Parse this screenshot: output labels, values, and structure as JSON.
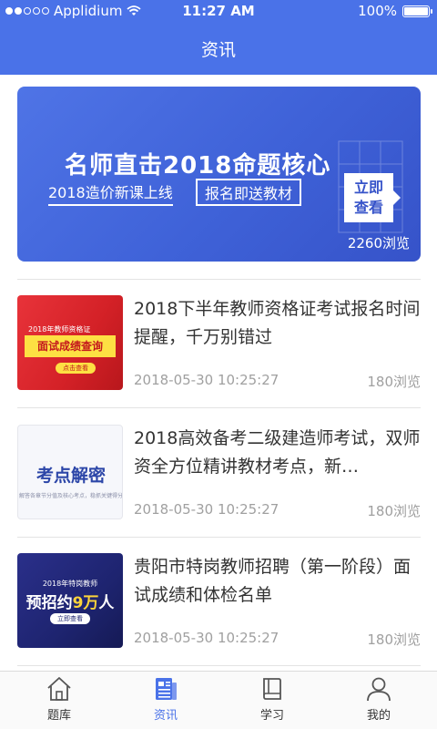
{
  "status_bar": {
    "carrier": "Applidium",
    "time": "11:27 AM",
    "battery": "100%",
    "battery_level": 1.0,
    "signal_bars_filled": 2,
    "signal_bars_total": 5
  },
  "header": {
    "title": "资讯"
  },
  "banner": {
    "headline": "名师直击2018命题核心",
    "subtitle_left": "2018造价新课上线",
    "subtitle_right": "报名即送教材",
    "cta_line1": "立即",
    "cta_line2": "查看",
    "views": "2260浏览"
  },
  "news": [
    {
      "title": "2018下半年教师资格证考试报名时间提醒，千万别错过",
      "date": "2018-05-30 10:25:27",
      "views": "180浏览",
      "thumb": {
        "tag": "2018年教师资格证",
        "main": "面试成绩查询",
        "button": "点击查看"
      }
    },
    {
      "title": "2018高效备考二级建造师考试，双师资全方位精讲教材考点，新…",
      "date": "2018-05-30 10:25:27",
      "views": "180浏览",
      "thumb": {
        "main": "考点解密",
        "small": "解答各章节分值及核心考点，稳抓关键得分"
      }
    },
    {
      "title": "贵阳市特岗教师招聘（第一阶段）面试成绩和体检名单",
      "date": "2018-05-30 10:25:27",
      "views": "180浏览",
      "thumb": {
        "tag": "2018年特岗教师",
        "main_prefix": "预招约",
        "main_num": "9万",
        "main_suffix": "人",
        "button": "立即查看"
      }
    }
  ],
  "tabs": [
    {
      "label": "题库",
      "icon": "home-icon",
      "active": false
    },
    {
      "label": "资讯",
      "icon": "news-icon",
      "active": true
    },
    {
      "label": "学习",
      "icon": "book-icon",
      "active": false
    },
    {
      "label": "我的",
      "icon": "user-icon",
      "active": false
    }
  ],
  "colors": {
    "primary": "#4a72e8",
    "text": "#333333",
    "muted": "#a0a0a0",
    "divider": "#e3e3e3"
  }
}
